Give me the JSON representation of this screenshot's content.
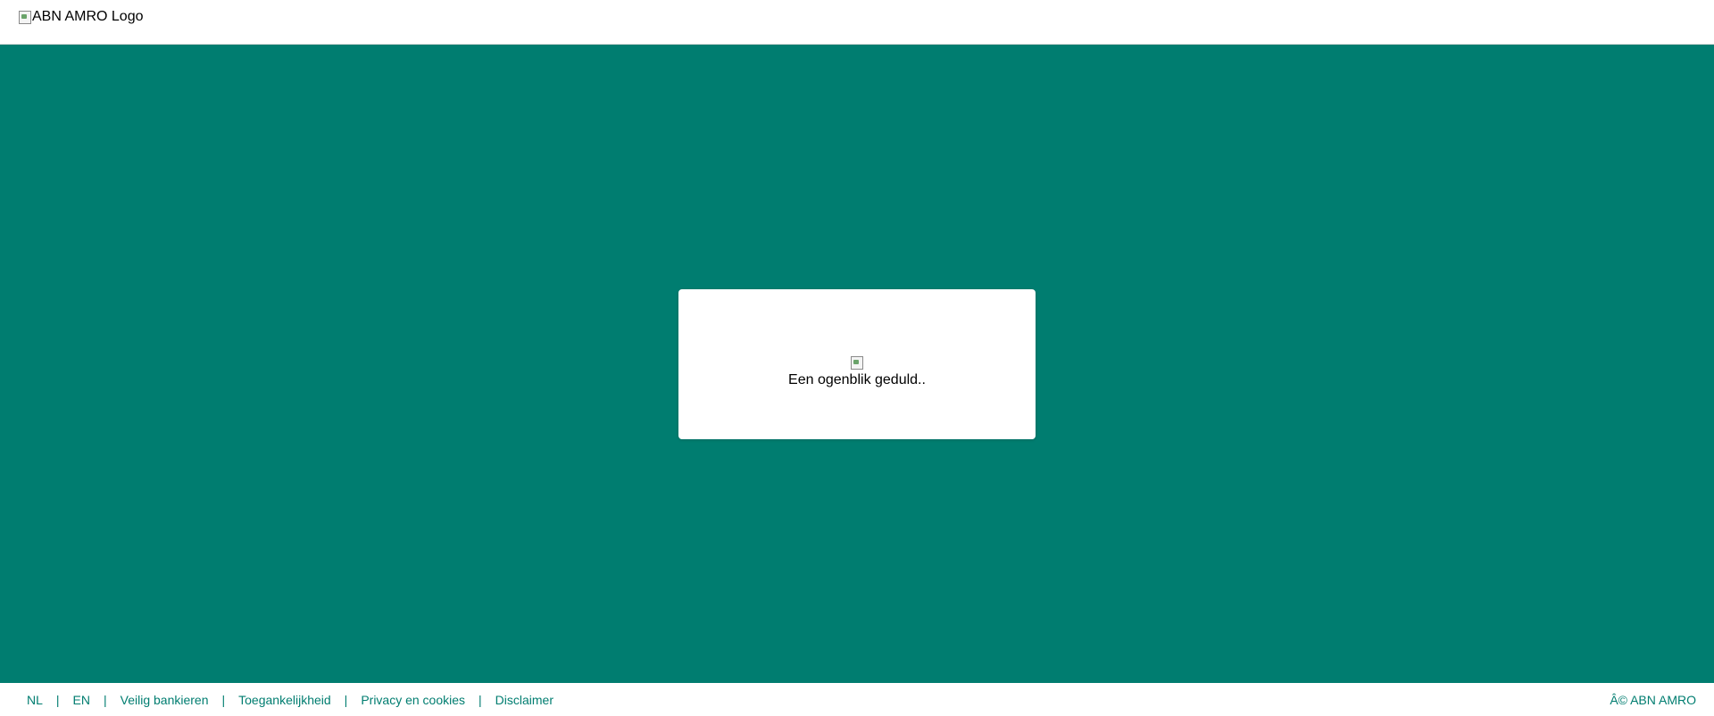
{
  "header": {
    "logo_alt": "ABN AMRO Logo",
    "logo_icon": "broken-image-icon"
  },
  "main": {
    "background_color": "#007d70",
    "loading": {
      "icon": "broken-image-icon",
      "message": "Een ogenblik geduld.."
    }
  },
  "footer": {
    "links": [
      {
        "label": "NL"
      },
      {
        "label": "EN"
      },
      {
        "label": "Veilig bankieren"
      },
      {
        "label": "Toegankelijkheid"
      },
      {
        "label": "Privacy en cookies"
      },
      {
        "label": "Disclaimer"
      }
    ],
    "separator": "|",
    "copyright": "Â© ABN AMRO",
    "link_color": "#007d70"
  }
}
